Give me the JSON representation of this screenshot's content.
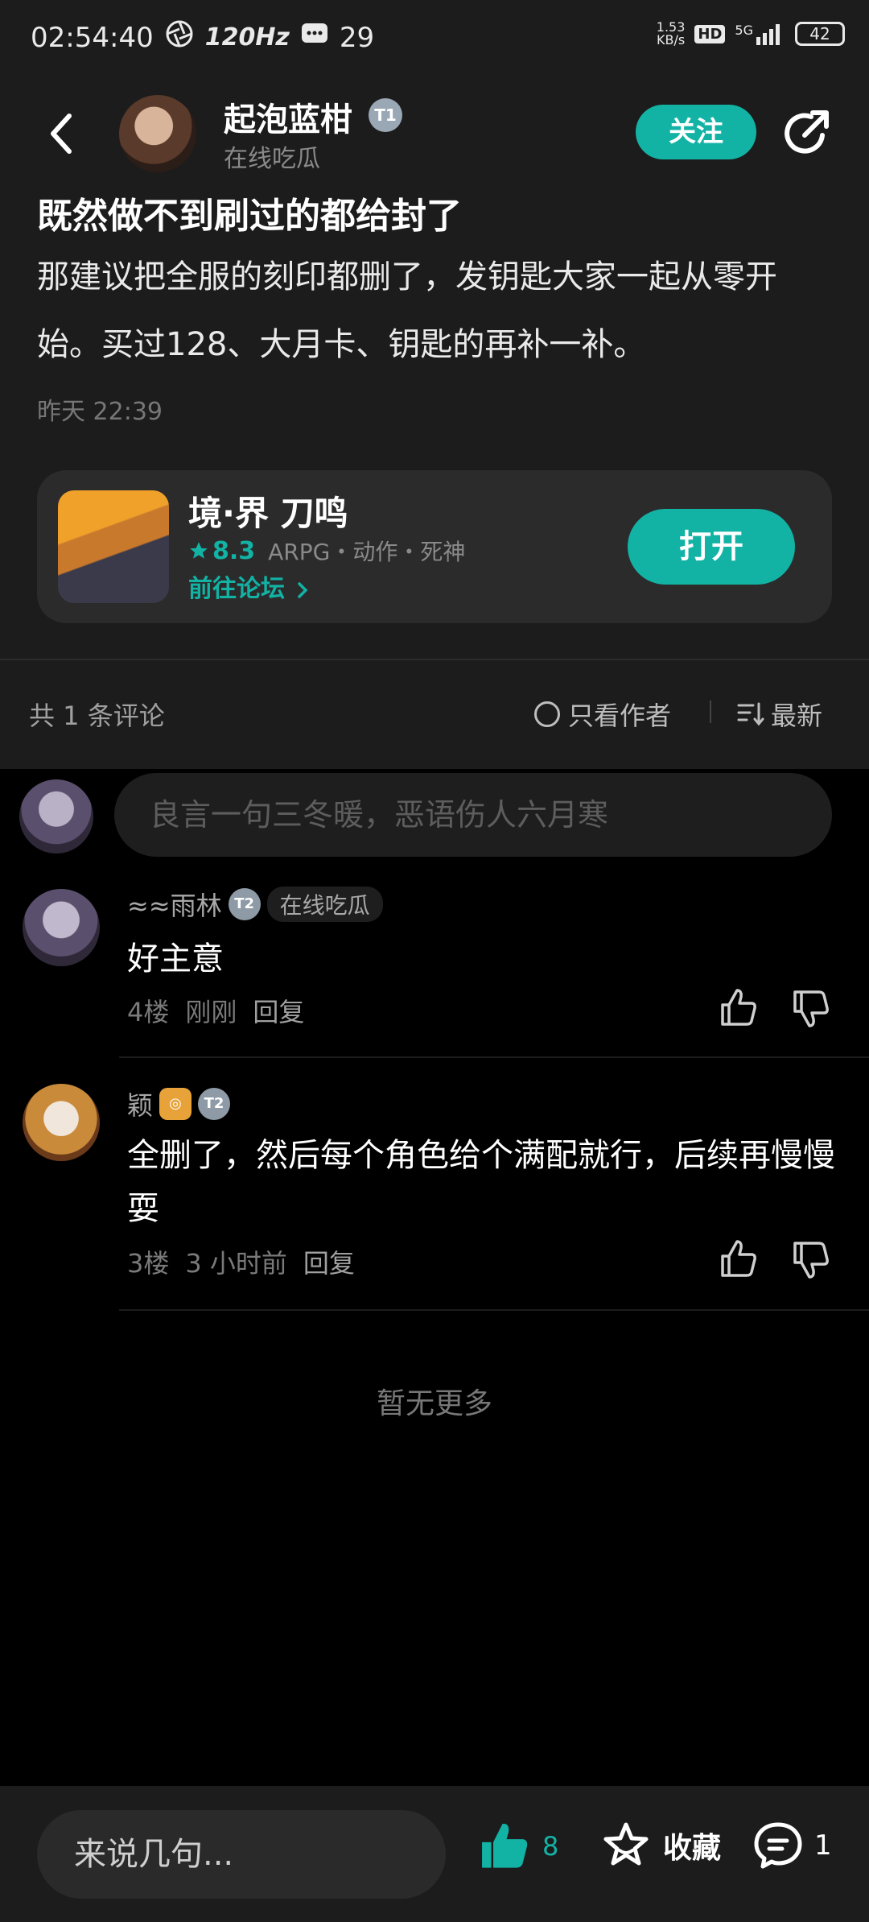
{
  "status_bar": {
    "time": "02:54:40",
    "refresh_rate": "120Hz",
    "notif_count": "29",
    "net_speed": "1.53",
    "net_unit": "KB/s",
    "hd": "HD",
    "network": "5G",
    "battery": "42"
  },
  "header": {
    "author_name": "起泡蓝柑",
    "author_level": "T1",
    "author_subtitle": "在线吃瓜",
    "follow_label": "关注"
  },
  "post": {
    "title": "既然做不到刷过的都给封了",
    "body": "那建议把全服的刻印都删了，发钥匙大家一起从零开始。买过128、大月卡、钥匙的再补一补。",
    "time": "昨天 22:39"
  },
  "game_card": {
    "name": "境·界 刀鸣",
    "rating": "8.3",
    "tags": "ARPG・动作・死神",
    "forum_link": "前往论坛",
    "open_label": "打开"
  },
  "comments_header": {
    "count_text": "共 1 条评论",
    "author_only_label": "只看作者",
    "sort_label": "最新"
  },
  "comment_input": {
    "placeholder": "良言一句三冬暖，恶语伤人六月寒"
  },
  "comments": [
    {
      "name": "≈≈雨林",
      "level": "T2",
      "tag": "在线吃瓜",
      "text": "好主意",
      "floor": "4楼",
      "time": "刚刚",
      "reply_label": "回复"
    },
    {
      "name": "颖",
      "level": "T2",
      "text": "全删了，然后每个角色给个满配就行，后续再慢慢耍",
      "floor": "3楼",
      "time": "3 小时前",
      "reply_label": "回复"
    }
  ],
  "no_more": "暂无更多",
  "bottom_bar": {
    "input_placeholder": "来说几句...",
    "like_count": "8",
    "fav_label": "收藏",
    "comment_count": "1"
  },
  "colors": {
    "accent": "#12b3a5",
    "panel": "#1c1c1c",
    "background": "#000000"
  }
}
